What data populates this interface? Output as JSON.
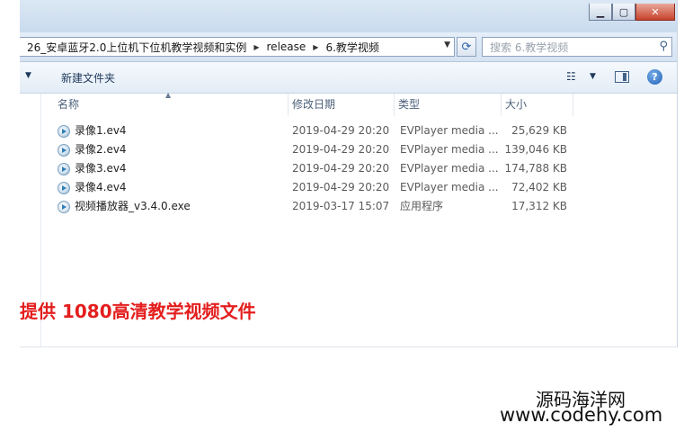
{
  "window": {
    "controls": {
      "minimize": "▁",
      "maximize": "▢",
      "close": "✕"
    }
  },
  "address": {
    "segments": [
      "26_安卓蓝牙2.0上位机下位机教学视频和实例",
      "release",
      "6.教学视频"
    ],
    "search_placeholder": "搜索 6.教学视频"
  },
  "toolbar": {
    "new_folder_label": "新建文件夹"
  },
  "columns": {
    "name": "名称",
    "date": "修改日期",
    "type": "类型",
    "size": "大小"
  },
  "files": [
    {
      "name": "录像1.ev4",
      "date": "2019-04-29 20:20",
      "type": "EVPlayer media ...",
      "size": "25,629 KB"
    },
    {
      "name": "录像2.ev4",
      "date": "2019-04-29 20:20",
      "type": "EVPlayer media ...",
      "size": "139,046 KB"
    },
    {
      "name": "录像3.ev4",
      "date": "2019-04-29 20:20",
      "type": "EVPlayer media ...",
      "size": "174,788 KB"
    },
    {
      "name": "录像4.ev4",
      "date": "2019-04-29 20:20",
      "type": "EVPlayer media ...",
      "size": "72,402 KB"
    },
    {
      "name": "视频播放器_v3.4.0.exe",
      "date": "2019-03-17 15:07",
      "type": "应用程序",
      "size": "17,312 KB"
    }
  ],
  "promo_text": "提供 1080高清教学视频文件",
  "watermark": {
    "line1": "源码海洋网",
    "line2": "www.codehy.com"
  },
  "colors": {
    "promo": "#e41e1e",
    "chrome": "#d5e3f2"
  }
}
